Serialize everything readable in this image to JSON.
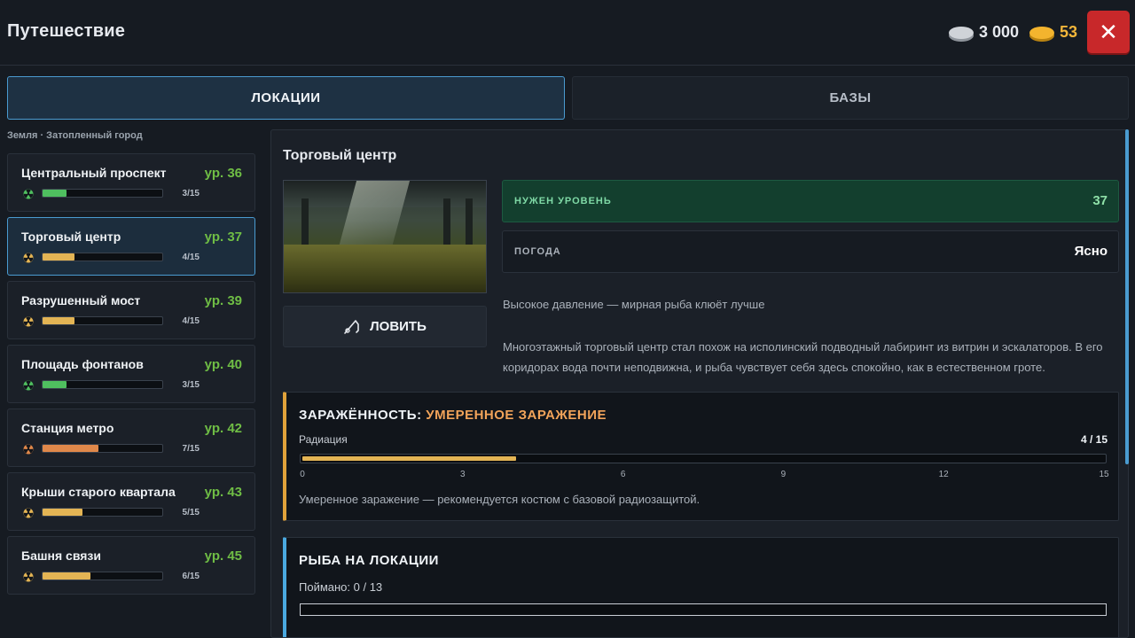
{
  "header": {
    "title": "Путешествие",
    "silver": "3 000",
    "gold": "53",
    "close_symbol": "✕"
  },
  "tabs": [
    {
      "label": "ЛОКАЦИИ",
      "active": true
    },
    {
      "label": "БАЗЫ",
      "active": false
    }
  ],
  "breadcrumb": "Земля · Затопленный город",
  "locations": [
    {
      "name": "Центральный проспект",
      "level": "ур. 36",
      "count": "3/15",
      "progress": 0.2,
      "rad_color": "#4fbf5f",
      "bar_color": "#4fbf5f",
      "active": false
    },
    {
      "name": "Торговый центр",
      "level": "ур. 37",
      "count": "4/15",
      "progress": 0.27,
      "rad_color": "#e3b454",
      "bar_color": "#e3b454",
      "active": true
    },
    {
      "name": "Разрушенный мост",
      "level": "ур. 39",
      "count": "4/15",
      "progress": 0.27,
      "rad_color": "#e3b454",
      "bar_color": "#e3b454",
      "active": false
    },
    {
      "name": "Площадь фонтанов",
      "level": "ур. 40",
      "count": "3/15",
      "progress": 0.2,
      "rad_color": "#4fbf5f",
      "bar_color": "#4fbf5f",
      "active": false
    },
    {
      "name": "Станция метро",
      "level": "ур. 42",
      "count": "7/15",
      "progress": 0.47,
      "rad_color": "#e0884a",
      "bar_color": "#e0884a",
      "active": false
    },
    {
      "name": "Крыши старого квартала",
      "level": "ур. 43",
      "count": "5/15",
      "progress": 0.33,
      "rad_color": "#e3b454",
      "bar_color": "#e3b454",
      "active": false
    },
    {
      "name": "Башня связи",
      "level": "ур. 45",
      "count": "6/15",
      "progress": 0.4,
      "rad_color": "#e3b454",
      "bar_color": "#e3b454",
      "active": false
    }
  ],
  "detail": {
    "title": "Торговый центр",
    "catch_label": "ЛОВИТЬ",
    "level_label": "НУЖЕН УРОВЕНЬ",
    "level_value": "37",
    "weather_label": "ПОГОДА",
    "weather_value": "Ясно",
    "hint": "Высокое давление — мирная рыба клюёт лучше",
    "description": "Многоэтажный торговый центр стал похож на исполинский подводный лабиринт из витрин и эскалаторов. В его коридорах вода почти неподвижна, и рыба чувствует себя здесь спокойно, как в естественном гроте."
  },
  "radiation": {
    "title_prefix": "ЗАРАЖЁННОСТЬ:",
    "title_level": "УМЕРЕННОЕ ЗАРАЖЕНИЕ",
    "label": "Радиация",
    "count": "4 / 15",
    "value": 4,
    "max": 15,
    "ticks": [
      "0",
      "3",
      "6",
      "9",
      "12",
      "15"
    ],
    "note": "Умеренное заражение — рекомендуется костюм с базовой радиозащитой."
  },
  "fish": {
    "title": "РЫБА НА ЛОКАЦИИ",
    "caught": "Поймано: 0 / 13",
    "progress": 0
  },
  "colors": {
    "accent_blue": "#4a9bd0",
    "level_green": "#6fbd45",
    "close_red": "#c8282a",
    "gold": "#f2b63a"
  }
}
